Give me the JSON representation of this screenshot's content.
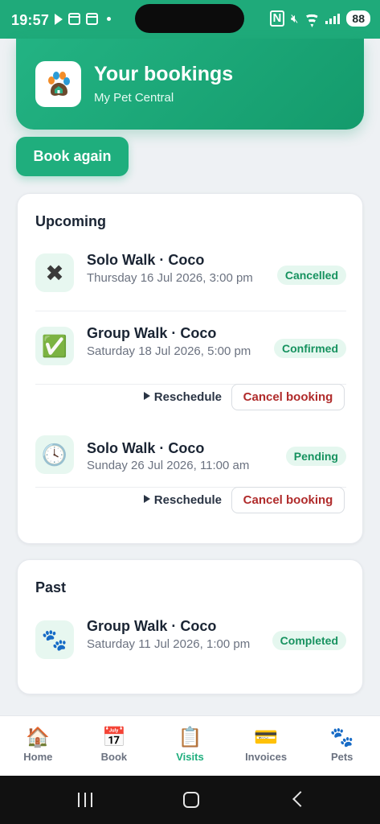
{
  "status_bar": {
    "time": "19:57",
    "battery": "88"
  },
  "header": {
    "title": "Your bookings",
    "subtitle": "My Pet Central",
    "logo_icon": "paw-logo"
  },
  "actions": {
    "book_again": "Book again"
  },
  "upcoming": {
    "title": "Upcoming",
    "bookings": [
      {
        "icon": "cross-mark-icon",
        "glyph": "✖",
        "title": "Solo Walk · Coco",
        "date": "Thursday 16 Jul 2026, 3:00 pm",
        "status": "Cancelled"
      },
      {
        "icon": "check-box-icon",
        "glyph": "✅",
        "title": "Group Walk · Coco",
        "date": "Saturday 18 Jul 2026, 5:00 pm",
        "status": "Confirmed",
        "reschedule": "Reschedule",
        "cancel": "Cancel booking"
      },
      {
        "icon": "clock-icon",
        "glyph": "🕓",
        "title": "Solo Walk · Coco",
        "date": "Sunday 26 Jul 2026, 11:00 am",
        "status": "Pending",
        "reschedule": "Reschedule",
        "cancel": "Cancel booking"
      }
    ]
  },
  "past": {
    "title": "Past",
    "bookings": [
      {
        "icon": "paw-prints-icon",
        "glyph": "🐾",
        "title": "Group Walk · Coco",
        "date": "Saturday 11 Jul 2026, 1:00 pm",
        "status": "Completed"
      }
    ]
  },
  "nav": {
    "items": [
      {
        "label": "Home",
        "icon": "house-icon",
        "glyph": "🏠"
      },
      {
        "label": "Book",
        "icon": "calendar-icon",
        "glyph": "📅"
      },
      {
        "label": "Visits",
        "icon": "clipboard-icon",
        "glyph": "📋",
        "active": true
      },
      {
        "label": "Invoices",
        "icon": "credit-card-icon",
        "glyph": "💳"
      },
      {
        "label": "Pets",
        "icon": "paw-prints-icon",
        "glyph": "🐾"
      }
    ]
  },
  "colors": {
    "accent": "#1fae7d",
    "cancel_text": "#b02b2b",
    "badge_bg": "#e5f7ef"
  }
}
